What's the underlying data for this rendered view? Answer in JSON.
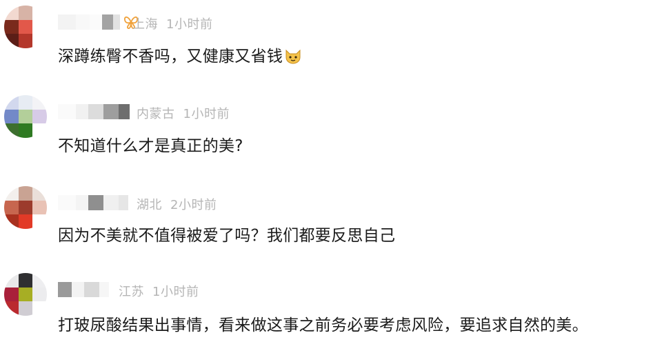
{
  "comments": [
    {
      "location": "上海",
      "time": "1小时前",
      "text": "深蹲练臀不香吗，又健康又省钱",
      "emoji": "cat-face-emoji",
      "badge": "butterfly-badge-icon",
      "avatar_colors": [
        "#f2d9d0",
        "#d7b3a6",
        "#ffffff",
        "#7a2a1c",
        "#e2584a",
        "#ffffff",
        "#5b1e17",
        "#b4372b",
        "#ffffff"
      ]
    },
    {
      "location": "内蒙古",
      "time": "1小时前",
      "text": "不知道什么才是真正的美?",
      "avatar_colors": [
        "#d2d8ee",
        "#e7ecf3",
        "#f3f3f6",
        "#7389c8",
        "#b3cf9a",
        "#d7cbe7",
        "#3d6f2f",
        "#2f7a22",
        "#ffffff"
      ]
    },
    {
      "location": "湖北",
      "time": "2小时前",
      "text": "因为不美就不值得被爱了吗？我们都要反思自己",
      "avatar_colors": [
        "#f3efec",
        "#c9a393",
        "#eadfd9",
        "#c7664f",
        "#9c3b2c",
        "#e9c2b5",
        "#a8311f",
        "#e23a27",
        "#ffffff"
      ]
    },
    {
      "location": "江苏",
      "time": "1小时前",
      "text": "打玻尿酸结果出事情，看来做这事之前务必要考虑风险，要追求自然的美。",
      "avatar_colors": [
        "#e9e9ea",
        "#2f2f31",
        "#eeeef0",
        "#a9203a",
        "#a7ae24",
        "#ececee",
        "#ba2a2f",
        "#d0cdd3",
        "#ffffff"
      ]
    }
  ],
  "colors": {
    "meta_text": "#b5b5b5",
    "content_text": "#1a1a1a",
    "badge_orange": "#f0a13a",
    "cat_yellow": "#f4c24a"
  }
}
